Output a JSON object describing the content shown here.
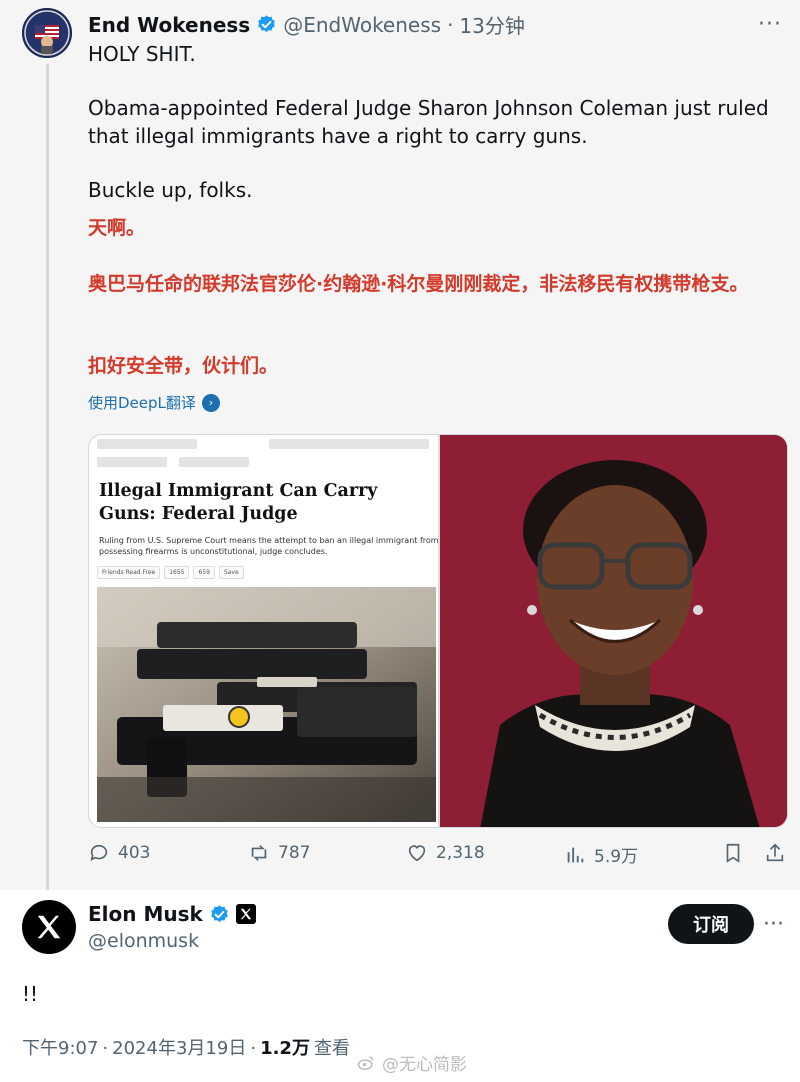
{
  "tweet": {
    "author_name": "End Wokeness",
    "author_handle": "@EndWokeness",
    "separator": "·",
    "time": "13分钟",
    "more": "···",
    "text_line1": "HOLY SHIT.",
    "text_line2": "Obama-appointed Federal Judge Sharon Johnson Coleman just ruled that illegal immigrants have a right to carry guns.",
    "text_line3": "Buckle up, folks.",
    "translation_line1": "天啊。",
    "translation_line2": "奥巴马任命的联邦法官莎伦·约翰逊·科尔曼刚刚裁定，非法移民有权携带枪支。",
    "translation_line3": "扣好安全带，伙计们。",
    "translate_link": "使用DeepL翻译",
    "media": {
      "article_title": "Illegal Immigrant Can Carry Guns: Federal Judge",
      "article_subtitle": "Ruling from U.S. Supreme Court means the attempt to ban an illegal immigrant from possessing firearms is unconstitutional, judge concludes.",
      "chips": [
        "Friends Read Free",
        "1655",
        "659",
        "Save"
      ]
    },
    "stats": {
      "replies": "403",
      "retweets": "787",
      "likes": "2,318",
      "views": "5.9万"
    }
  },
  "reply": {
    "author_name": "Elon Musk",
    "author_handle": "@elonmusk",
    "subscribe_label": "订阅",
    "more": "···",
    "text": "!!",
    "time": "下午9:07",
    "separator": "·",
    "date": "2024年3月19日",
    "views_count": "1.2万",
    "views_label": "查看",
    "watermark": "@无心简影"
  },
  "colors": {
    "accent_blue": "#1d9bf0",
    "translation_red": "#d33a2c",
    "judge_background": "#8e1e34"
  }
}
